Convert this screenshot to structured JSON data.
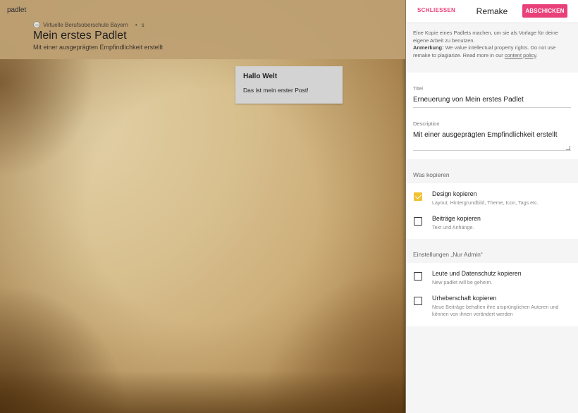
{
  "board": {
    "brand": "padlet",
    "author": "Virtuelle Berufsoberschule Bayern",
    "dot": "•",
    "extra": "s",
    "title": "Mein erstes Padlet",
    "subtitle": "Mit einer ausgeprägten Empfindlichkeit erstellt"
  },
  "post": {
    "title": "Hallo Welt",
    "body": "Das ist mein erster Post!"
  },
  "panel": {
    "close_label": "SCHLIESSEN",
    "title": "Remake",
    "submit_label": "ABSCHICKEN",
    "intro_text": "Eine Kopie eines Padlets machen, um sie als Vorlage für deine eigene Arbeit zu benutzen.",
    "note_label": "Anmerkung:",
    "note_text": "We value intellectual property rights. Do not use remake to plagiarize. Read more in our",
    "policy_link": "content policy",
    "period": ".",
    "title_field": {
      "label": "Titel",
      "value": "Erneuerung von Mein erstes Padlet"
    },
    "description_field": {
      "label": "Description",
      "value": "Mit einer ausgeprägten Empfindlichkeit erstellt"
    },
    "copy_section": {
      "header": "Was kopieren",
      "options": [
        {
          "title": "Design kopieren",
          "desc": "Layout, Hintergrundbild, Theme, Icon, Tags etc.",
          "checked": true
        },
        {
          "title": "Beiträge kopieren",
          "desc": "Text und Anhänge.",
          "checked": false
        }
      ]
    },
    "admin_section": {
      "header": "Einstellungen „Nur Admin“",
      "options": [
        {
          "title": "Leute und Datenschutz kopieren",
          "desc": "New padlet will be geheim.",
          "checked": false
        },
        {
          "title": "Urheberschaft kopieren",
          "desc": "Neue Beiträge behalten ihre ursprünglichen Autoren und können von ihnen verändert werden",
          "checked": false
        }
      ]
    },
    "accent_color": "#e9407a",
    "check_color": "#f1c232"
  }
}
